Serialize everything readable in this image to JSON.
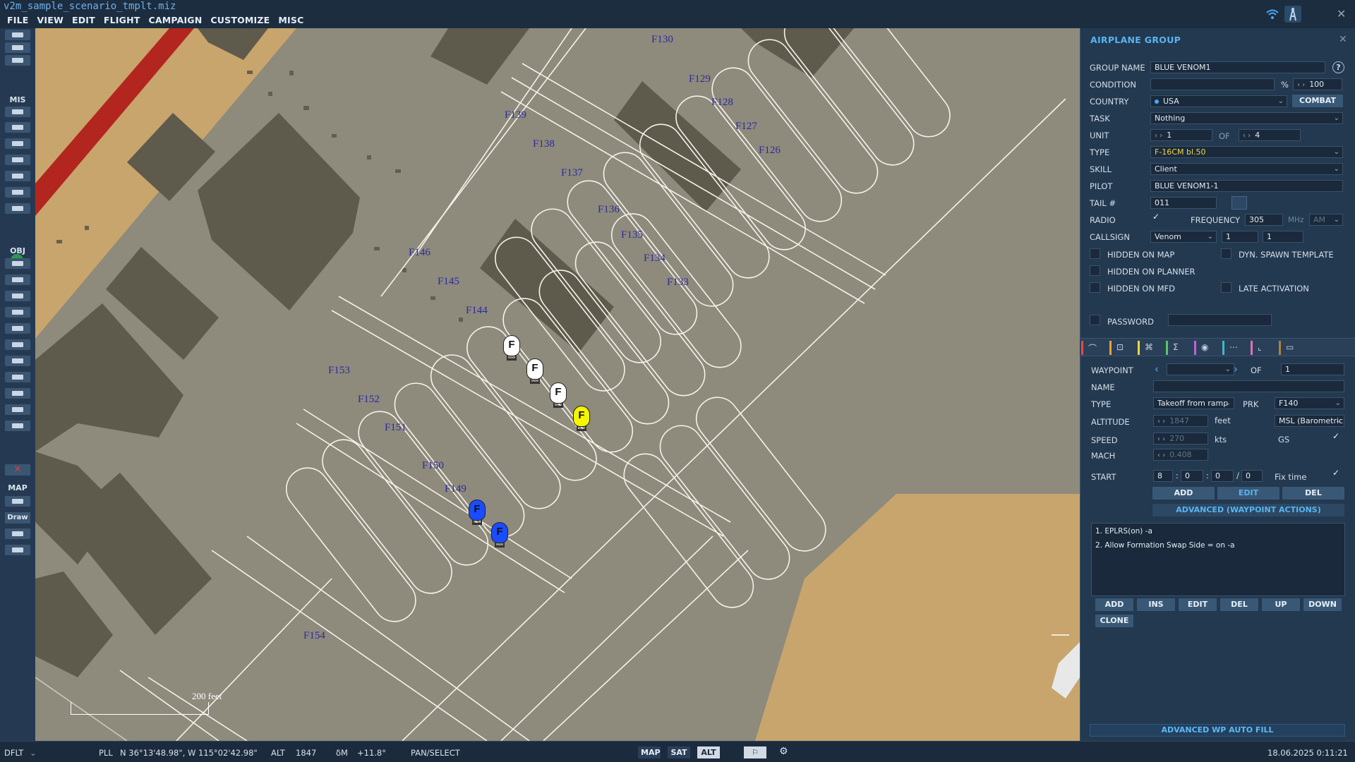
{
  "app": {
    "file_title": "v2m_sample_scenario_tmplt.miz",
    "menu": [
      "FILE",
      "VIEW",
      "EDIT",
      "FLIGHT",
      "CAMPAIGN",
      "CUSTOMIZE",
      "MISC"
    ]
  },
  "toolbar": {
    "section_mis": "MIS",
    "section_obj": "OBJ",
    "section_map": "MAP",
    "draw_label": "Draw"
  },
  "map": {
    "stand_labels": [
      "F130",
      "F129",
      "F128",
      "F127",
      "F126",
      "F139",
      "F138",
      "F137",
      "F136",
      "F135",
      "F134",
      "F133",
      "F146",
      "F145",
      "F144",
      "F153",
      "F152",
      "F151",
      "F150",
      "F149",
      "F154"
    ],
    "units": [
      {
        "letter": "F",
        "color": "#ffffff"
      },
      {
        "letter": "F",
        "color": "#ffffff"
      },
      {
        "letter": "F",
        "color": "#ffffff"
      },
      {
        "letter": "F",
        "color": "#f5f500"
      },
      {
        "letter": "F",
        "color": "#1a4cff"
      },
      {
        "letter": "F",
        "color": "#1a4cff"
      }
    ],
    "scale_label": "200 feet"
  },
  "panel": {
    "title": "AIRPLANE GROUP",
    "group_name_label": "GROUP NAME",
    "group_name": "BLUE VENOM1",
    "condition_label": "CONDITION",
    "condition_unit": "%",
    "condition_value": "100",
    "country_label": "COUNTRY",
    "country": "USA",
    "combat_button": "COMBAT",
    "task_label": "TASK",
    "task": "Nothing",
    "unit_label": "UNIT",
    "unit_value": "1",
    "unit_of_label": "OF",
    "unit_total": "4",
    "type_label": "TYPE",
    "type": "F-16CM bl.50",
    "skill_label": "SKILL",
    "skill": "Client",
    "pilot_label": "PILOT",
    "pilot": "BLUE VENOM1-1",
    "tail_label": "TAIL #",
    "tail": "011",
    "radio_label": "RADIO",
    "frequency_label": "FREQUENCY",
    "frequency": "305",
    "frequency_unit": "MHz",
    "modulation": "AM",
    "callsign_label": "CALLSIGN",
    "callsign": "Venom",
    "callsign_num1": "1",
    "callsign_num2": "1",
    "hidden_on_map": "HIDDEN ON MAP",
    "dyn_spawn": "DYN. SPAWN TEMPLATE",
    "hidden_on_planner": "HIDDEN ON PLANNER",
    "hidden_on_mfd": "HIDDEN ON MFD",
    "late_activation": "LATE ACTIVATION",
    "password_label": "PASSWORD"
  },
  "waypoint": {
    "waypoint_label": "WAYPOINT",
    "of_label": "OF",
    "of_value": "1",
    "name_label": "NAME",
    "type_label": "TYPE",
    "type": "Takeoff from ramp",
    "prk_label": "PRK",
    "prk": "F140",
    "altitude_label": "ALTITUDE",
    "altitude": "1847",
    "altitude_unit": "feet",
    "altitude_ref": "MSL (Barometric)",
    "speed_label": "SPEED",
    "speed": "270",
    "speed_unit": "kts",
    "gs_label": "GS",
    "mach_label": "MACH",
    "mach": "0.408",
    "start_label": "START",
    "start_d": "8",
    "start_h": "0",
    "start_m": "0",
    "start_s": "0",
    "fix_time_label": "Fix time",
    "add": "ADD",
    "edit": "EDIT",
    "del": "DEL",
    "advanced": "ADVANCED (WAYPOINT ACTIONS)",
    "actions": [
      "1. EPLRS(on)  -a",
      "2. Allow Formation Swap Side = on -a"
    ],
    "action_buttons": [
      "ADD",
      "INS",
      "EDIT",
      "DEL",
      "UP",
      "DOWN"
    ],
    "clone": "CLONE",
    "auto_fill": "ADVANCED WP AUTO FILL"
  },
  "status": {
    "profile": "DFLT",
    "coord_sys": "PLL",
    "coords": "N 36°13'48.98\", W 115°02'42.98\"",
    "alt_label": "ALT",
    "alt_value": "1847",
    "dm_label": "δM",
    "dm_value": "+11.8°",
    "mode": "PAN/SELECT",
    "map_btn": "MAP",
    "sat_btn": "SAT",
    "alt_btn": "ALT",
    "datetime": "18.06.2025 0:11:21"
  },
  "colors": {
    "accent": "#58b4f0",
    "map_ground": "#8e8a7c",
    "sand": "#c8a56c",
    "buildings": "#5e5a4c",
    "runway_red": "#b2261f"
  }
}
